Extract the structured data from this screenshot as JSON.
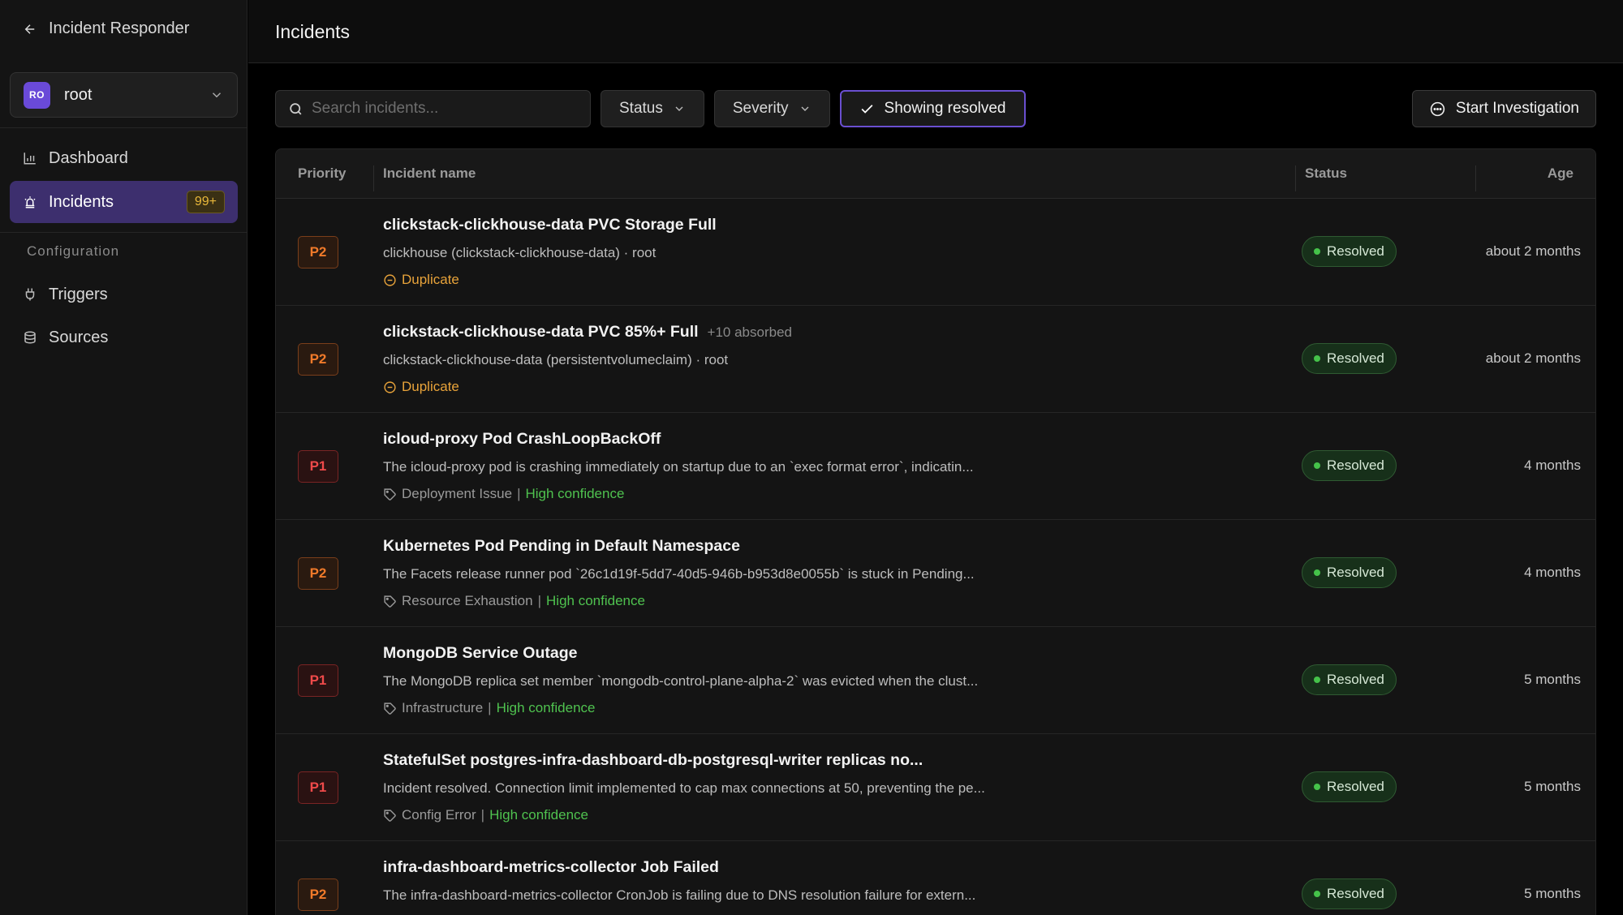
{
  "sidebar": {
    "back_label": "Incident Responder",
    "org": {
      "initials": "RO",
      "name": "root"
    },
    "nav": [
      {
        "label": "Dashboard",
        "icon": "bar-chart-icon"
      },
      {
        "label": "Incidents",
        "icon": "alarm-icon",
        "badge": "99+"
      }
    ],
    "config_label": "Configuration",
    "config_items": [
      {
        "label": "Triggers",
        "icon": "plug-icon"
      },
      {
        "label": "Sources",
        "icon": "database-icon"
      }
    ]
  },
  "header": {
    "title": "Incidents"
  },
  "toolbar": {
    "search_placeholder": "Search incidents...",
    "status_label": "Status",
    "severity_label": "Severity",
    "resolved_label": "Showing resolved",
    "start_label": "Start Investigation"
  },
  "table": {
    "columns": {
      "priority": "Priority",
      "name": "Incident name",
      "status": "Status",
      "age": "Age"
    },
    "rows": [
      {
        "priority": "P2",
        "title": "clickstack-clickhouse-data PVC Storage Full",
        "absorbed": "",
        "desc": "clickhouse (clickstack-clickhouse-data) · root",
        "meta_type": "duplicate",
        "meta_label": "Duplicate",
        "confidence": "",
        "status": "Resolved",
        "age": "about 2 months"
      },
      {
        "priority": "P2",
        "title": "clickstack-clickhouse-data PVC 85%+ Full",
        "absorbed": "+10 absorbed",
        "desc": "clickstack-clickhouse-data (persistentvolumeclaim) · root",
        "meta_type": "duplicate",
        "meta_label": "Duplicate",
        "confidence": "",
        "status": "Resolved",
        "age": "about 2 months"
      },
      {
        "priority": "P1",
        "title": "icloud-proxy Pod CrashLoopBackOff",
        "absorbed": "",
        "desc": "The icloud-proxy pod is crashing immediately on startup due to an `exec format error`, indicatin...",
        "meta_type": "tag",
        "meta_label": "Deployment Issue",
        "confidence": "High confidence",
        "status": "Resolved",
        "age": "4 months"
      },
      {
        "priority": "P2",
        "title": "Kubernetes Pod Pending in Default Namespace",
        "absorbed": "",
        "desc": "The Facets release runner pod `26c1d19f-5dd7-40d5-946b-b953d8e0055b` is stuck in Pending...",
        "meta_type": "tag",
        "meta_label": "Resource Exhaustion",
        "confidence": "High confidence",
        "status": "Resolved",
        "age": "4 months"
      },
      {
        "priority": "P1",
        "title": "MongoDB Service Outage",
        "absorbed": "",
        "desc": "The MongoDB replica set member `mongodb-control-plane-alpha-2` was evicted when the clust...",
        "meta_type": "tag",
        "meta_label": "Infrastructure",
        "confidence": "High confidence",
        "status": "Resolved",
        "age": "5 months"
      },
      {
        "priority": "P1",
        "title": "StatefulSet postgres-infra-dashboard-db-postgresql-writer replicas no...",
        "absorbed": "",
        "desc": "Incident resolved. Connection limit implemented to cap max connections at 50, preventing the pe...",
        "meta_type": "tag",
        "meta_label": "Config Error",
        "confidence": "High confidence",
        "status": "Resolved",
        "age": "5 months"
      },
      {
        "priority": "P2",
        "title": "infra-dashboard-metrics-collector Job Failed",
        "absorbed": "",
        "desc": "The infra-dashboard-metrics-collector CronJob is failing due to DNS resolution failure for extern...",
        "meta_type": "tag",
        "meta_label": "",
        "confidence": "",
        "status": "Resolved",
        "age": "5 months"
      }
    ]
  },
  "colors": {
    "accent": "#6a4fd0",
    "p1": "#ef4a4a",
    "p2": "#f07a2a",
    "resolved": "#45c24a",
    "duplicate": "#e8a33a"
  }
}
